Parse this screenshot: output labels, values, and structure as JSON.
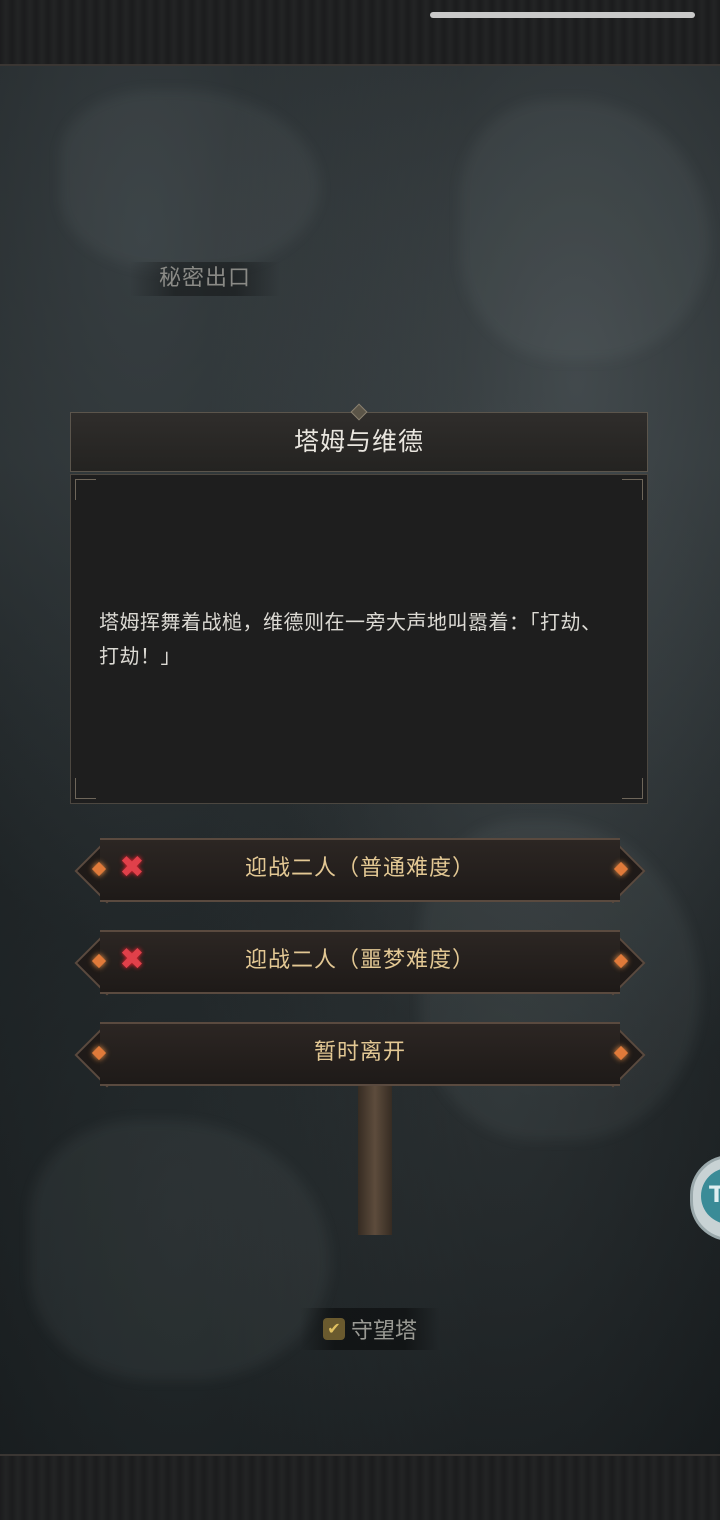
{
  "map": {
    "location_secret_exit": "秘密出口",
    "location_watchtower": "守望塔"
  },
  "dialog": {
    "title": "塔姆与维德",
    "text": "塔姆挥舞着战槌，维德则在一旁大声地叫嚣着：「打劫、打劫！」"
  },
  "choices": [
    {
      "label": "迎战二人（普通难度）",
      "locked_icon": "x"
    },
    {
      "label": "迎战二人（噩梦难度）",
      "locked_icon": "x"
    },
    {
      "label": "暂时离开"
    }
  ],
  "side_button": {
    "glyph": "T"
  },
  "icons": {
    "locked": "red-x-icon",
    "watchtower": "check-shield-icon"
  },
  "colors": {
    "choice_text": "#e3c894",
    "dialog_text": "#dcdad4",
    "accent_orange": "#e07a3a",
    "lock_red": "#e0404a"
  }
}
